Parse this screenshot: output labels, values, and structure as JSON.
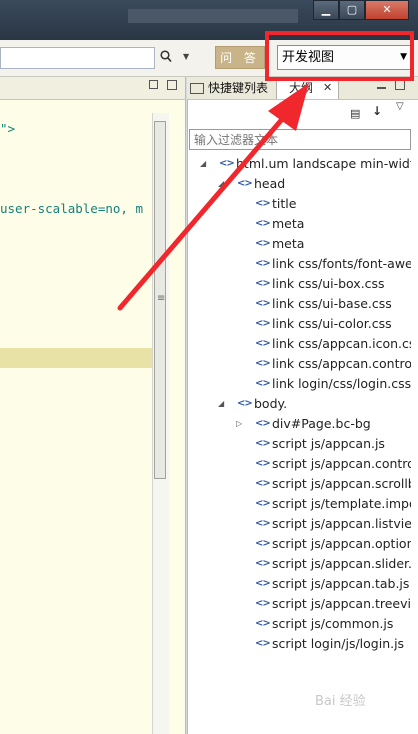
{
  "window": {
    "title": "",
    "min_glyph": "▁",
    "max_glyph": "▢",
    "close_glyph": "✕"
  },
  "toolbar": {
    "search_icon": "search-icon",
    "wenda_label": "问 答",
    "view_select_value": "开发视图"
  },
  "editor": {
    "lines": [
      {
        "text": "\">"
      },
      {
        "text": "user-scalable=no, m"
      }
    ]
  },
  "panel": {
    "tab_shortcuts_label": "快捷键列表",
    "tab_outline_label": "大纲",
    "filter_placeholder": "输入过滤器文本",
    "tree": [
      {
        "label": "html.um landscape min-width-",
        "indent": 0,
        "twisty": "expanded"
      },
      {
        "label": "head",
        "indent": 1,
        "twisty": "expanded"
      },
      {
        "label": "title",
        "indent": 2,
        "twisty": "none"
      },
      {
        "label": "meta",
        "indent": 2,
        "twisty": "none"
      },
      {
        "label": "meta",
        "indent": 2,
        "twisty": "none"
      },
      {
        "label": "link css/fonts/font-awes",
        "indent": 2,
        "twisty": "none"
      },
      {
        "label": "link css/ui-box.css",
        "indent": 2,
        "twisty": "none"
      },
      {
        "label": "link css/ui-base.css",
        "indent": 2,
        "twisty": "none"
      },
      {
        "label": "link css/ui-color.css",
        "indent": 2,
        "twisty": "none"
      },
      {
        "label": "link css/appcan.icon.css",
        "indent": 2,
        "twisty": "none"
      },
      {
        "label": "link css/appcan.control.",
        "indent": 2,
        "twisty": "none"
      },
      {
        "label": "link login/css/login.css",
        "indent": 2,
        "twisty": "none"
      },
      {
        "label": "body.",
        "indent": 1,
        "twisty": "expanded"
      },
      {
        "label": "div#Page.bc-bg",
        "indent": 2,
        "twisty": "collapsed"
      },
      {
        "label": "script js/appcan.js",
        "indent": 2,
        "twisty": "none"
      },
      {
        "label": "script js/appcan.control",
        "indent": 2,
        "twisty": "none"
      },
      {
        "label": "script js/appcan.scrollbo",
        "indent": 2,
        "twisty": "none"
      },
      {
        "label": "script js/template.impor",
        "indent": 2,
        "twisty": "none"
      },
      {
        "label": "script js/appcan.listview",
        "indent": 2,
        "twisty": "none"
      },
      {
        "label": "script js/appcan.optionL",
        "indent": 2,
        "twisty": "none"
      },
      {
        "label": "script js/appcan.slider.js",
        "indent": 2,
        "twisty": "none"
      },
      {
        "label": "script js/appcan.tab.js",
        "indent": 2,
        "twisty": "none"
      },
      {
        "label": "script js/appcan.treeview",
        "indent": 2,
        "twisty": "none"
      },
      {
        "label": "script js/common.js",
        "indent": 2,
        "twisty": "none"
      },
      {
        "label": "script login/js/login.js",
        "indent": 2,
        "twisty": "none"
      }
    ]
  },
  "watermark": "Bai 经验",
  "colors": {
    "highlight": "#f0272d",
    "tag_icon": "#2d5aa8",
    "code_text": "#16807c",
    "editor_bg": "#fefde8",
    "current_line": "#e9e2a6"
  }
}
